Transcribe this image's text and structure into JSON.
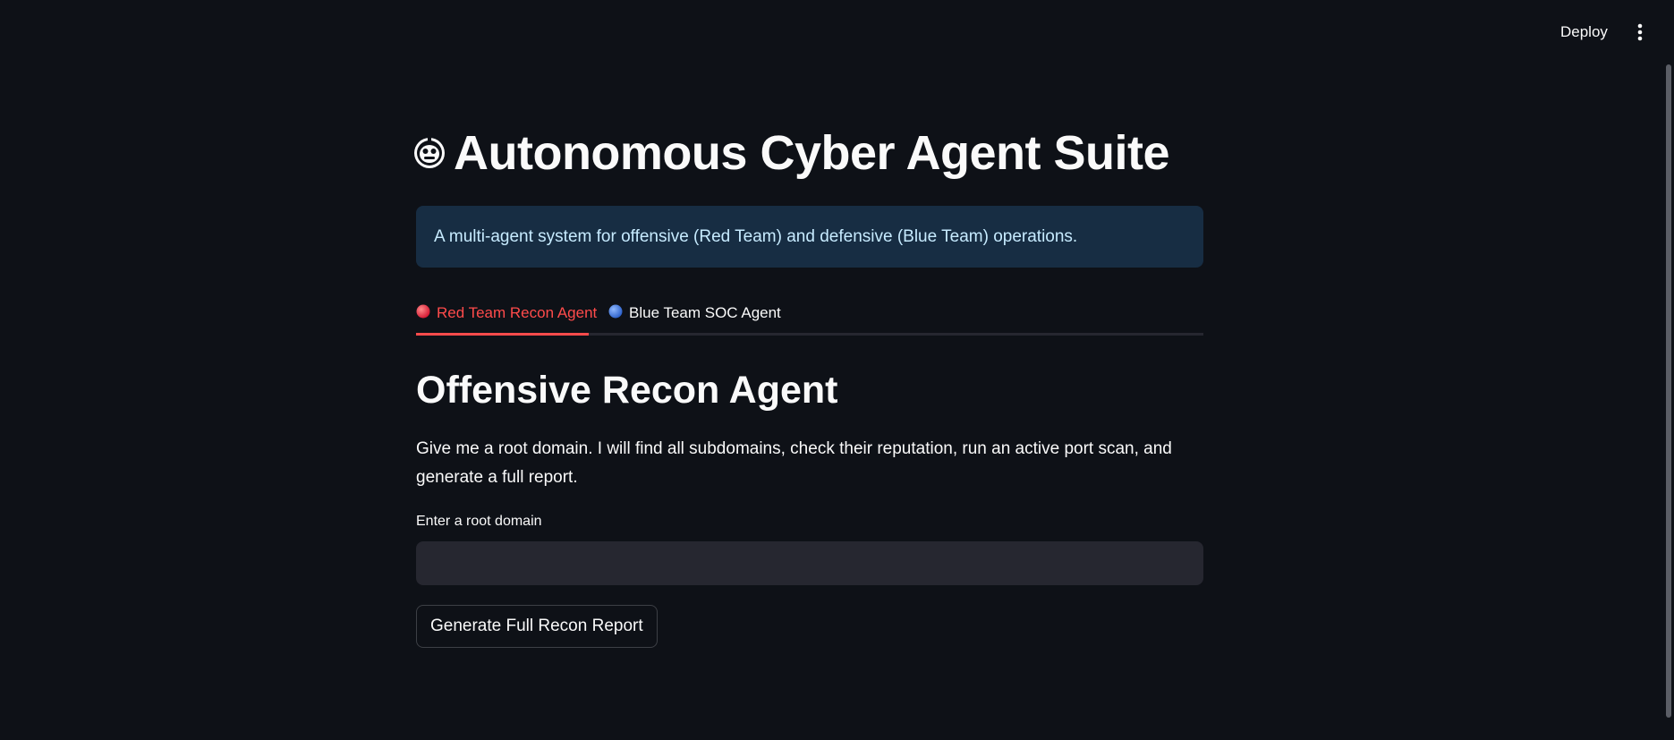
{
  "header": {
    "deploy_label": "Deploy",
    "menu_icon": "more-vertical-icon"
  },
  "main": {
    "title_icon": "robot-face-icon",
    "title": "Autonomous Cyber Agent Suite",
    "info_text": "A multi-agent system for offensive (Red Team) and defensive (Blue Team) operations.",
    "tabs": [
      {
        "label": "Red Team Recon Agent",
        "icon": "red-circle-icon",
        "active": true
      },
      {
        "label": "Blue Team SOC Agent",
        "icon": "blue-circle-icon",
        "active": false
      }
    ],
    "section_heading": "Offensive Recon Agent",
    "description": "Give me a root domain. I will find all subdomains, check their reputation, run an active port scan, and generate a full report.",
    "domain_field": {
      "label": "Enter a root domain",
      "value": "",
      "placeholder": ""
    },
    "generate_button_label": "Generate Full Recon Report"
  },
  "colors": {
    "background": "#0e1117",
    "accent": "#ff4b4b",
    "info_bg": "#172d43",
    "info_text": "#c7ebff",
    "input_bg": "#262730"
  }
}
